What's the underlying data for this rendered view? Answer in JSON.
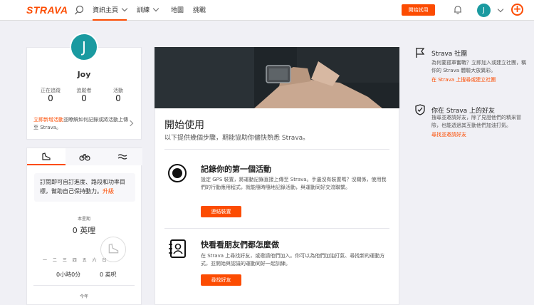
{
  "header": {
    "logo": "STRAVA",
    "nav": [
      "資訊主頁",
      "訓練",
      "地圖",
      "挑戰"
    ],
    "trial_button": "開始試用",
    "avatar_initial": "J",
    "plus": "+"
  },
  "profile": {
    "initial": "J",
    "name": "Joy",
    "stats": [
      {
        "label": "正在追蹤",
        "value": "0"
      },
      {
        "label": "追蹤者",
        "value": "0"
      },
      {
        "label": "活動",
        "value": "0"
      }
    ],
    "promo_link": "立即新增活動",
    "promo_text": "並瞭解如何記錄或將活動上傳至 Strava。"
  },
  "goals": {
    "text": "訂閱即可自訂進度、路段和功率目標，幫助自己保持動力。",
    "upgrade": "升級",
    "week_label": "本星期",
    "week_value": "0 英哩",
    "days": "一 二 三 四 五 六 日",
    "time_value": "0小時0分",
    "elev_value": "0 英呎",
    "year_label": "今年"
  },
  "main": {
    "title": "開始使用",
    "subtitle": "以下提供幾個步驟，期能協助你儘快熟悉 Strava。",
    "steps": [
      {
        "title": "記錄你的第一個活動",
        "desc": "設定 GPS 裝置，將運動記錄直接上傳至 Strava。手邊沒有裝置嗎？沒關係，使用我們的行動應用程式，就能隨時隨地記錄活動，與運動同好交流聯繫。",
        "button": "連結裝置"
      },
      {
        "title": "快看看朋友們都怎麼做",
        "desc": "在 Strava 上尋找好友，或邀請他們加入。你可以為他們加油打氣、尋找新的運動方式，並開始與認識的運動同好一起訓練。",
        "button": "尋找好友"
      }
    ]
  },
  "sidebar": {
    "club": {
      "title": "Strava 社團",
      "desc": "為何要孤軍奮戰？立即加入或建立社團，稱你的 Strava 體驗大放異彩。",
      "link": "在 Strava 上搜尋或建立社團"
    },
    "friends": {
      "title": "你在 Strava 上的好友",
      "desc": "搜尋並邀請好友，除了見證他們的精采冒險，也能透過其互動他們加油打氣。",
      "link": "尋找並邀請好友"
    }
  },
  "colors": {
    "accent": "#fc4c02",
    "avatar": "#1a9aa0"
  }
}
